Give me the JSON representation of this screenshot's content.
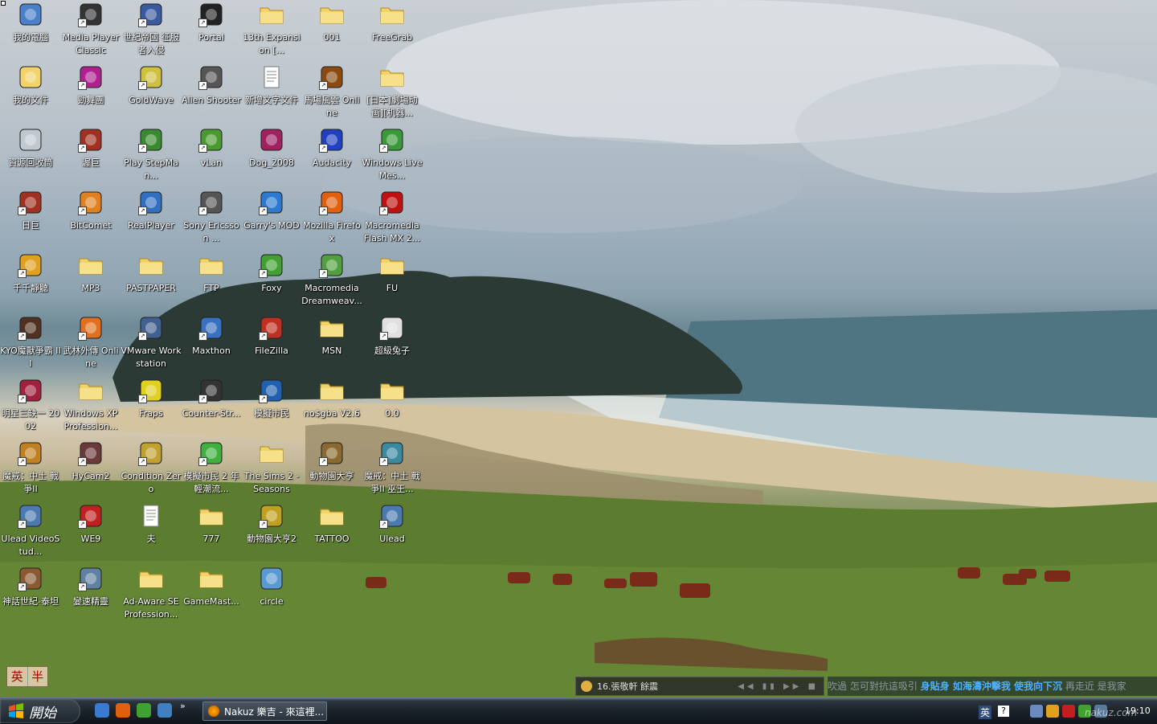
{
  "desktop": {
    "icons": [
      {
        "label": "我的電腦",
        "icon": "my-computer-icon",
        "shortcut": false,
        "color": "#4a7fc9"
      },
      {
        "label": "Media Player Classic",
        "icon": "media-player-icon",
        "shortcut": true,
        "color": "#333333"
      },
      {
        "label": "世紀帝國 征服者入侵",
        "icon": "age-of-empires-icon",
        "shortcut": true,
        "color": "#3a5aa0"
      },
      {
        "label": "Portal",
        "icon": "portal-icon",
        "shortcut": true,
        "color": "#222222"
      },
      {
        "label": "13th Expansion [...",
        "icon": "folder-icon",
        "shortcut": false,
        "color": "#f2d36a"
      },
      {
        "label": "001",
        "icon": "folder-icon",
        "shortcut": false,
        "color": "#f2d36a"
      },
      {
        "label": "FreeGrab",
        "icon": "folder-icon",
        "shortcut": false,
        "color": "#f2d36a"
      },
      {
        "label": "我的文件",
        "icon": "my-documents-icon",
        "shortcut": false,
        "color": "#f2d36a"
      },
      {
        "label": "勁舞團",
        "icon": "audition-icon",
        "shortcut": true,
        "color": "#b02090"
      },
      {
        "label": "GoldWave",
        "icon": "goldwave-icon",
        "shortcut": true,
        "color": "#d0c040"
      },
      {
        "label": "Alien Shooter",
        "icon": "alien-shooter-icon",
        "shortcut": true,
        "color": "#555555"
      },
      {
        "label": "新增文字文件",
        "icon": "text-file-icon",
        "shortcut": false,
        "color": "#ffffff"
      },
      {
        "label": "馬場風雲 Online",
        "icon": "horse-racing-icon",
        "shortcut": true,
        "color": "#8a4a10"
      },
      {
        "label": "[日本]劇場动画][机器...",
        "icon": "folder-icon",
        "shortcut": false,
        "color": "#f2d36a"
      },
      {
        "label": "資源回收筒",
        "icon": "recycle-bin-icon",
        "shortcut": false,
        "color": "#c0c8d0"
      },
      {
        "label": "渥巨",
        "icon": "game-icon",
        "shortcut": true,
        "color": "#a03020"
      },
      {
        "label": "Play StepMan...",
        "icon": "stepmania-icon",
        "shortcut": true,
        "color": "#3a8a30"
      },
      {
        "label": "vLan",
        "icon": "vlan-icon",
        "shortcut": true,
        "color": "#4a9a30"
      },
      {
        "label": "Dog_2008",
        "icon": "winrar-icon",
        "shortcut": false,
        "color": "#a02060"
      },
      {
        "label": "Audacity",
        "icon": "audacity-icon",
        "shortcut": true,
        "color": "#2040c0"
      },
      {
        "label": "Windows Live Mes...",
        "icon": "messenger-icon",
        "shortcut": true,
        "color": "#3a9a3a"
      },
      {
        "label": "日巨",
        "icon": "game-icon",
        "shortcut": true,
        "color": "#a03020"
      },
      {
        "label": "BitComet",
        "icon": "bitcomet-icon",
        "shortcut": true,
        "color": "#e08020"
      },
      {
        "label": "RealPlayer",
        "icon": "realplayer-icon",
        "shortcut": true,
        "color": "#3070c0"
      },
      {
        "label": "Sony Ericsson ...",
        "icon": "phone-icon",
        "shortcut": true,
        "color": "#555555"
      },
      {
        "label": "Garry's MOD",
        "icon": "garrys-mod-icon",
        "shortcut": true,
        "color": "#2a7ad0"
      },
      {
        "label": "Mozilla Firefox",
        "icon": "firefox-icon",
        "shortcut": true,
        "color": "#e06010"
      },
      {
        "label": "Macromedia Flash MX 2...",
        "icon": "flash-icon",
        "shortcut": true,
        "color": "#c01010"
      },
      {
        "label": "千千靜聽",
        "icon": "ttplayer-icon",
        "shortcut": true,
        "color": "#e0a020"
      },
      {
        "label": "MP3",
        "icon": "folder-icon",
        "shortcut": false,
        "color": "#f2d36a"
      },
      {
        "label": "PASTPAPER",
        "icon": "folder-icon",
        "shortcut": false,
        "color": "#f2d36a"
      },
      {
        "label": "FTP",
        "icon": "folder-icon",
        "shortcut": false,
        "color": "#f2d36a"
      },
      {
        "label": "Foxy",
        "icon": "foxy-icon",
        "shortcut": true,
        "color": "#40a030"
      },
      {
        "label": "Macromedia Dreamweav...",
        "icon": "dreamweaver-icon",
        "shortcut": true,
        "color": "#50a040"
      },
      {
        "label": "FU",
        "icon": "folder-icon",
        "shortcut": false,
        "color": "#f2d36a"
      },
      {
        "label": "KYO魔獸爭霸 III",
        "icon": "warcraft-icon",
        "shortcut": true,
        "color": "#503020"
      },
      {
        "label": "武林外傳 Online",
        "icon": "wulin-icon",
        "shortcut": true,
        "color": "#e07020"
      },
      {
        "label": "VMware Workstation",
        "icon": "vmware-icon",
        "shortcut": true,
        "color": "#406090"
      },
      {
        "label": "Maxthon",
        "icon": "maxthon-icon",
        "shortcut": true,
        "color": "#3a70c0"
      },
      {
        "label": "FileZilla",
        "icon": "filezilla-icon",
        "shortcut": true,
        "color": "#c03020"
      },
      {
        "label": "MSN",
        "icon": "folder-icon",
        "shortcut": false,
        "color": "#f2d36a"
      },
      {
        "label": "超級兔子",
        "icon": "rabbit-icon",
        "shortcut": true,
        "color": "#e0e0e0"
      },
      {
        "label": "明星三缺一 2002",
        "icon": "mahjong-icon",
        "shortcut": true,
        "color": "#a02040"
      },
      {
        "label": "Windows XP Profession...",
        "icon": "folder-icon",
        "shortcut": false,
        "color": "#f2d36a"
      },
      {
        "label": "Fraps",
        "icon": "fraps-icon",
        "shortcut": true,
        "color": "#e0d020"
      },
      {
        "label": "Counter-Str...",
        "icon": "counter-strike-icon",
        "shortcut": true,
        "color": "#333333"
      },
      {
        "label": "模擬市民",
        "icon": "sims-icon",
        "shortcut": true,
        "color": "#2060b0"
      },
      {
        "label": "no$gba V2.6",
        "icon": "folder-icon",
        "shortcut": false,
        "color": "#f2d36a"
      },
      {
        "label": "0.0",
        "icon": "folder-icon",
        "shortcut": false,
        "color": "#f2d36a"
      },
      {
        "label": "魔戒：中土 戰爭II",
        "icon": "lotr-icon",
        "shortcut": true,
        "color": "#c08020"
      },
      {
        "label": "HyCam2",
        "icon": "hycam-icon",
        "shortcut": true,
        "color": "#6a3a3a"
      },
      {
        "label": "Condition Zero",
        "icon": "condition-zero-icon",
        "shortcut": true,
        "color": "#c0a030"
      },
      {
        "label": "模擬市民 2 年輕潮流...",
        "icon": "sims2-icon",
        "shortcut": true,
        "color": "#40b040"
      },
      {
        "label": "The Sims 2 - Seasons",
        "icon": "folder-icon",
        "shortcut": false,
        "color": "#f2d36a"
      },
      {
        "label": "動物園大亨",
        "icon": "zoo-tycoon-icon",
        "shortcut": true,
        "color": "#8a6a30"
      },
      {
        "label": "魔戒：中土 戰爭II 巫王...",
        "icon": "lotr-icon",
        "shortcut": true,
        "color": "#3a8aa0"
      },
      {
        "label": "Ulead VideoStud...",
        "icon": "ulead-icon",
        "shortcut": true,
        "color": "#4a7ab0"
      },
      {
        "label": "WE9",
        "icon": "we9-icon",
        "shortcut": true,
        "color": "#c02020"
      },
      {
        "label": "夫",
        "icon": "text-file-icon",
        "shortcut": false,
        "color": "#ffffff"
      },
      {
        "label": "777",
        "icon": "folder-icon",
        "shortcut": false,
        "color": "#f2d36a"
      },
      {
        "label": "動物園大亨2",
        "icon": "zoo-tycoon-icon",
        "shortcut": true,
        "color": "#c0a020"
      },
      {
        "label": "TATTOO",
        "icon": "folder-icon",
        "shortcut": false,
        "color": "#f2d36a"
      },
      {
        "label": "Ulead",
        "icon": "ulead-icon",
        "shortcut": true,
        "color": "#4a7ab0"
      },
      {
        "label": "神話世紀-泰坦",
        "icon": "age-of-mythology-icon",
        "shortcut": true,
        "color": "#8a5a30"
      },
      {
        "label": "變速精靈",
        "icon": "speed-gear-icon",
        "shortcut": true,
        "color": "#6080a0"
      },
      {
        "label": "Ad-Aware SE Profession...",
        "icon": "folder-icon",
        "shortcut": false,
        "color": "#f2d36a"
      },
      {
        "label": "GameMast...",
        "icon": "folder-icon",
        "shortcut": false,
        "color": "#f2d36a"
      },
      {
        "label": "circle",
        "icon": "image-file-icon",
        "shortcut": false,
        "color": "#5a9ad0"
      }
    ]
  },
  "ime": {
    "lang_label": "英",
    "width_label": "半"
  },
  "music_player": {
    "track": "16.張敬軒 餘震",
    "controls": "◀◀ ▮▮ ▶▶ ■"
  },
  "lyrics": {
    "previous": "吹過 怎可對抗這吸引",
    "current": "身貼身 如海濤沖擊我 使我向下沉",
    "next": "再走近 是我家"
  },
  "taskbar": {
    "start_label": "開始",
    "quick_launch_more": "»",
    "task_item": "Nakuz 樂吉 - 來這裡...",
    "lang_indicator": "英",
    "help_label": "?",
    "clock": "19:10"
  },
  "watermark": "nakuz.com",
  "colors": {
    "taskbar_bg": "#1b2229",
    "label_text": "#ffffff",
    "folder": "#f2d36a"
  }
}
